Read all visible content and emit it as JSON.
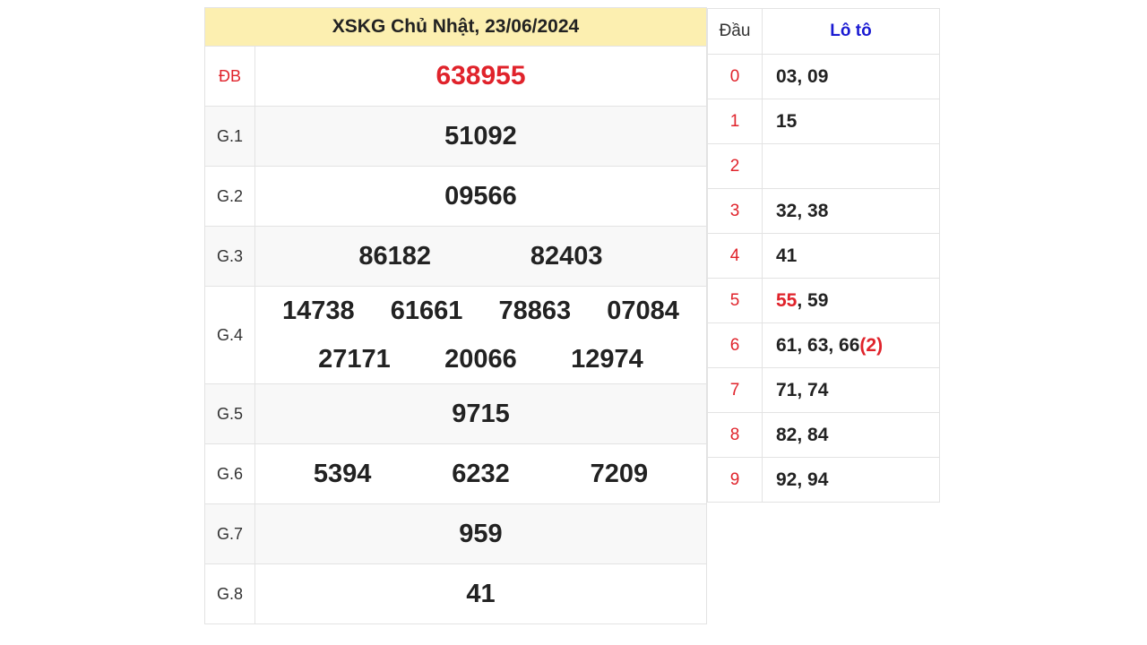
{
  "title": "XSKG Chủ Nhật, 23/06/2024",
  "prizes": [
    {
      "label": "ĐB",
      "numbers": [
        "638955"
      ]
    },
    {
      "label": "G.1",
      "numbers": [
        "51092"
      ]
    },
    {
      "label": "G.2",
      "numbers": [
        "09566"
      ]
    },
    {
      "label": "G.3",
      "numbers": [
        "86182",
        "82403"
      ]
    },
    {
      "label": "G.4",
      "numbers": [
        "14738",
        "61661",
        "78863",
        "07084",
        "27171",
        "20066",
        "12974"
      ]
    },
    {
      "label": "G.5",
      "numbers": [
        "9715"
      ]
    },
    {
      "label": "G.6",
      "numbers": [
        "5394",
        "6232",
        "7209"
      ]
    },
    {
      "label": "G.7",
      "numbers": [
        "959"
      ]
    },
    {
      "label": "G.8",
      "numbers": [
        "41"
      ]
    }
  ],
  "loto": {
    "header_dau": "Đầu",
    "header_loto": "Lô tô",
    "rows": [
      {
        "dau": "0",
        "parts": [
          {
            "t": "03, 09"
          }
        ]
      },
      {
        "dau": "1",
        "parts": [
          {
            "t": "15"
          }
        ]
      },
      {
        "dau": "2",
        "parts": []
      },
      {
        "dau": "3",
        "parts": [
          {
            "t": "32, 38"
          }
        ]
      },
      {
        "dau": "4",
        "parts": [
          {
            "t": "41"
          }
        ]
      },
      {
        "dau": "5",
        "parts": [
          {
            "t": "55",
            "red": true
          },
          {
            "t": ", 59"
          }
        ]
      },
      {
        "dau": "6",
        "parts": [
          {
            "t": "61, 63, 66"
          },
          {
            "t": "(2)",
            "red": true
          }
        ]
      },
      {
        "dau": "7",
        "parts": [
          {
            "t": "71, 74"
          }
        ]
      },
      {
        "dau": "8",
        "parts": [
          {
            "t": "82, 84"
          }
        ]
      },
      {
        "dau": "9",
        "parts": [
          {
            "t": "92, 94"
          }
        ]
      }
    ]
  },
  "colors": {
    "header_bg": "#fcefb0",
    "red": "#e0232b",
    "blue": "#1a1ad2"
  }
}
